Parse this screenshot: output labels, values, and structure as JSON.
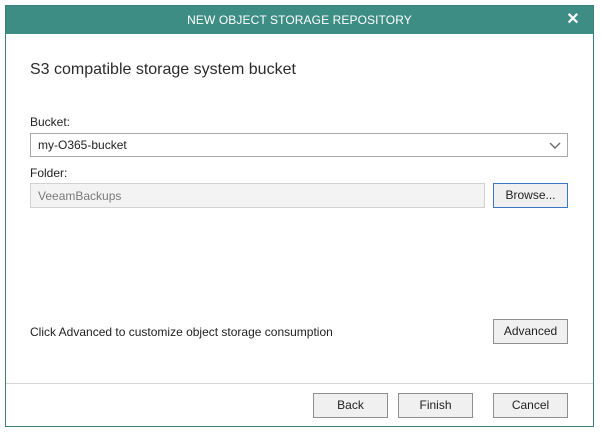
{
  "window": {
    "title": "NEW OBJECT STORAGE REPOSITORY",
    "close_label": "✕"
  },
  "page": {
    "title": "S3 compatible storage system bucket"
  },
  "bucket": {
    "label": "Bucket:",
    "value": "my-O365-bucket"
  },
  "folder": {
    "label": "Folder:",
    "value": "VeeamBackups",
    "browse_label": "Browse..."
  },
  "advanced": {
    "hint": "Click Advanced to customize object storage consumption",
    "button_label": "Advanced"
  },
  "footer": {
    "back_label": "Back",
    "finish_label": "Finish",
    "cancel_label": "Cancel"
  },
  "colors": {
    "titlebar": "#3e8d85",
    "focus_border": "#3a76c4"
  }
}
